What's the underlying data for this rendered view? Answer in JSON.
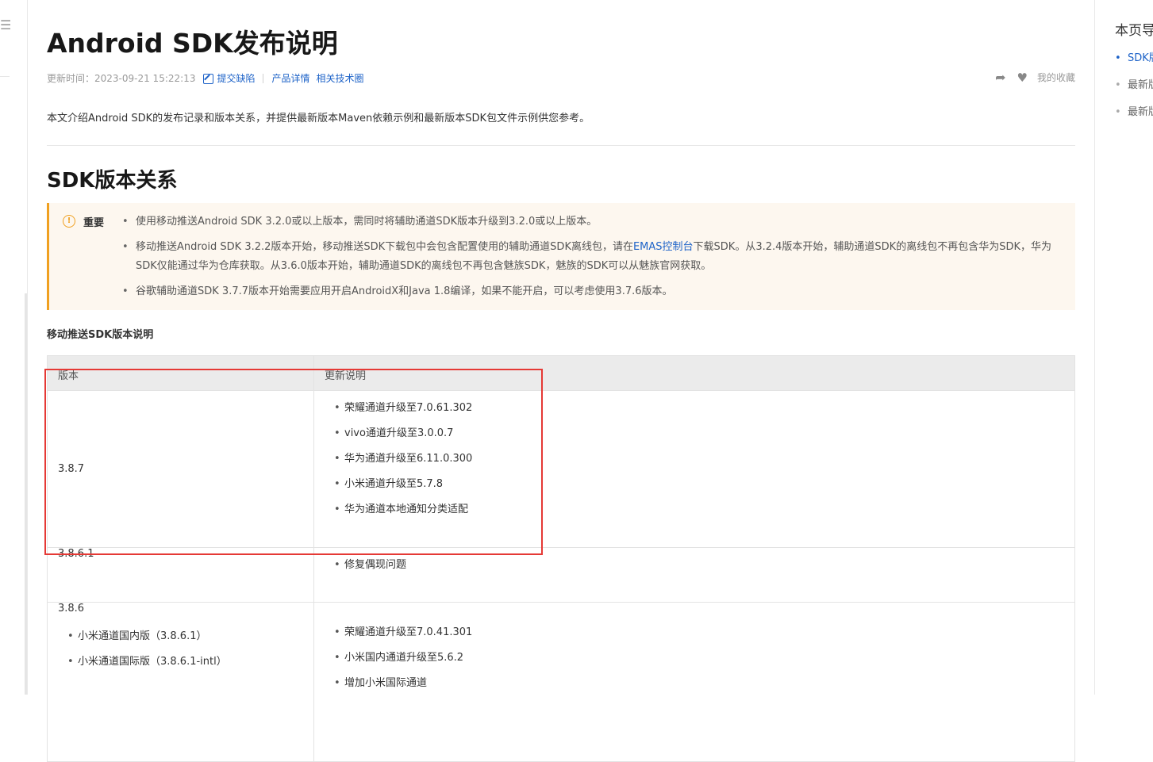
{
  "page": {
    "title": "Android SDK发布说明",
    "updated_label": "更新时间：2023-09-21 15:22:13",
    "links": {
      "report_bug": "提交缺陷",
      "product_detail": "产品详情",
      "tech_circle": "相关技术圈"
    },
    "favorite_label": "我的收藏",
    "intro": "本文介绍Android SDK的发布记录和版本关系，并提供最新版本Maven依赖示例和最新版本SDK包文件示例供您参考。"
  },
  "section": {
    "title": "SDK版本关系",
    "notice": {
      "label": "重要",
      "items": [
        "使用移动推送Android SDK 3.2.0或以上版本，需同时将辅助通道SDK版本升级到3.2.0或以上版本。",
        "谷歌辅助通道SDK 3.7.7版本开始需要应用开启AndroidX和Java 1.8编译，如果不能开启，可以考虑使用3.7.6版本。"
      ],
      "item2_part1": "移动推送Android SDK 3.2.2版本开始，移动推送SDK下载包中会包含配置使用的辅助通道SDK离线包，请在",
      "item2_link": "EMAS控制台",
      "item2_part2": "下载SDK。从3.2.4版本开始，辅助通道SDK的离线包不再包含华为SDK，华为SDK仅能通过华为仓库获取。从3.6.0版本开始，辅助通道SDK的离线包不再包含魅族SDK，魅族的SDK可以从魅族官网获取。"
    },
    "sub_title": "移动推送SDK版本说明"
  },
  "table": {
    "headers": [
      "版本",
      "更新说明"
    ],
    "rows": [
      {
        "version": "3.8.7",
        "notes": [
          "荣耀通道升级至7.0.61.302",
          "vivo通道升级至3.0.0.7",
          "华为通道升级至6.11.0.300",
          "小米通道升级至5.7.8",
          "华为通道本地通知分类适配"
        ]
      },
      {
        "version": "3.8.6.1",
        "notes": [
          "修复偶现问题"
        ]
      },
      {
        "version": "3.8.6",
        "sub_versions": [
          "小米通道国内版（3.8.6.1）",
          "小米通道国际版（3.8.6.1-intl）"
        ],
        "notes": [
          "荣耀通道升级至7.0.41.301",
          "小米国内通道升级至5.6.2",
          "增加小米国际通道"
        ]
      }
    ]
  },
  "toc": {
    "title": "本页导",
    "items": [
      "SDK版",
      "最新版",
      "最新版"
    ]
  },
  "colors": {
    "accent": "#1e63c8",
    "notice_border": "#f0a020",
    "notice_bg": "#fdf7ef",
    "highlight": "#e53935"
  }
}
